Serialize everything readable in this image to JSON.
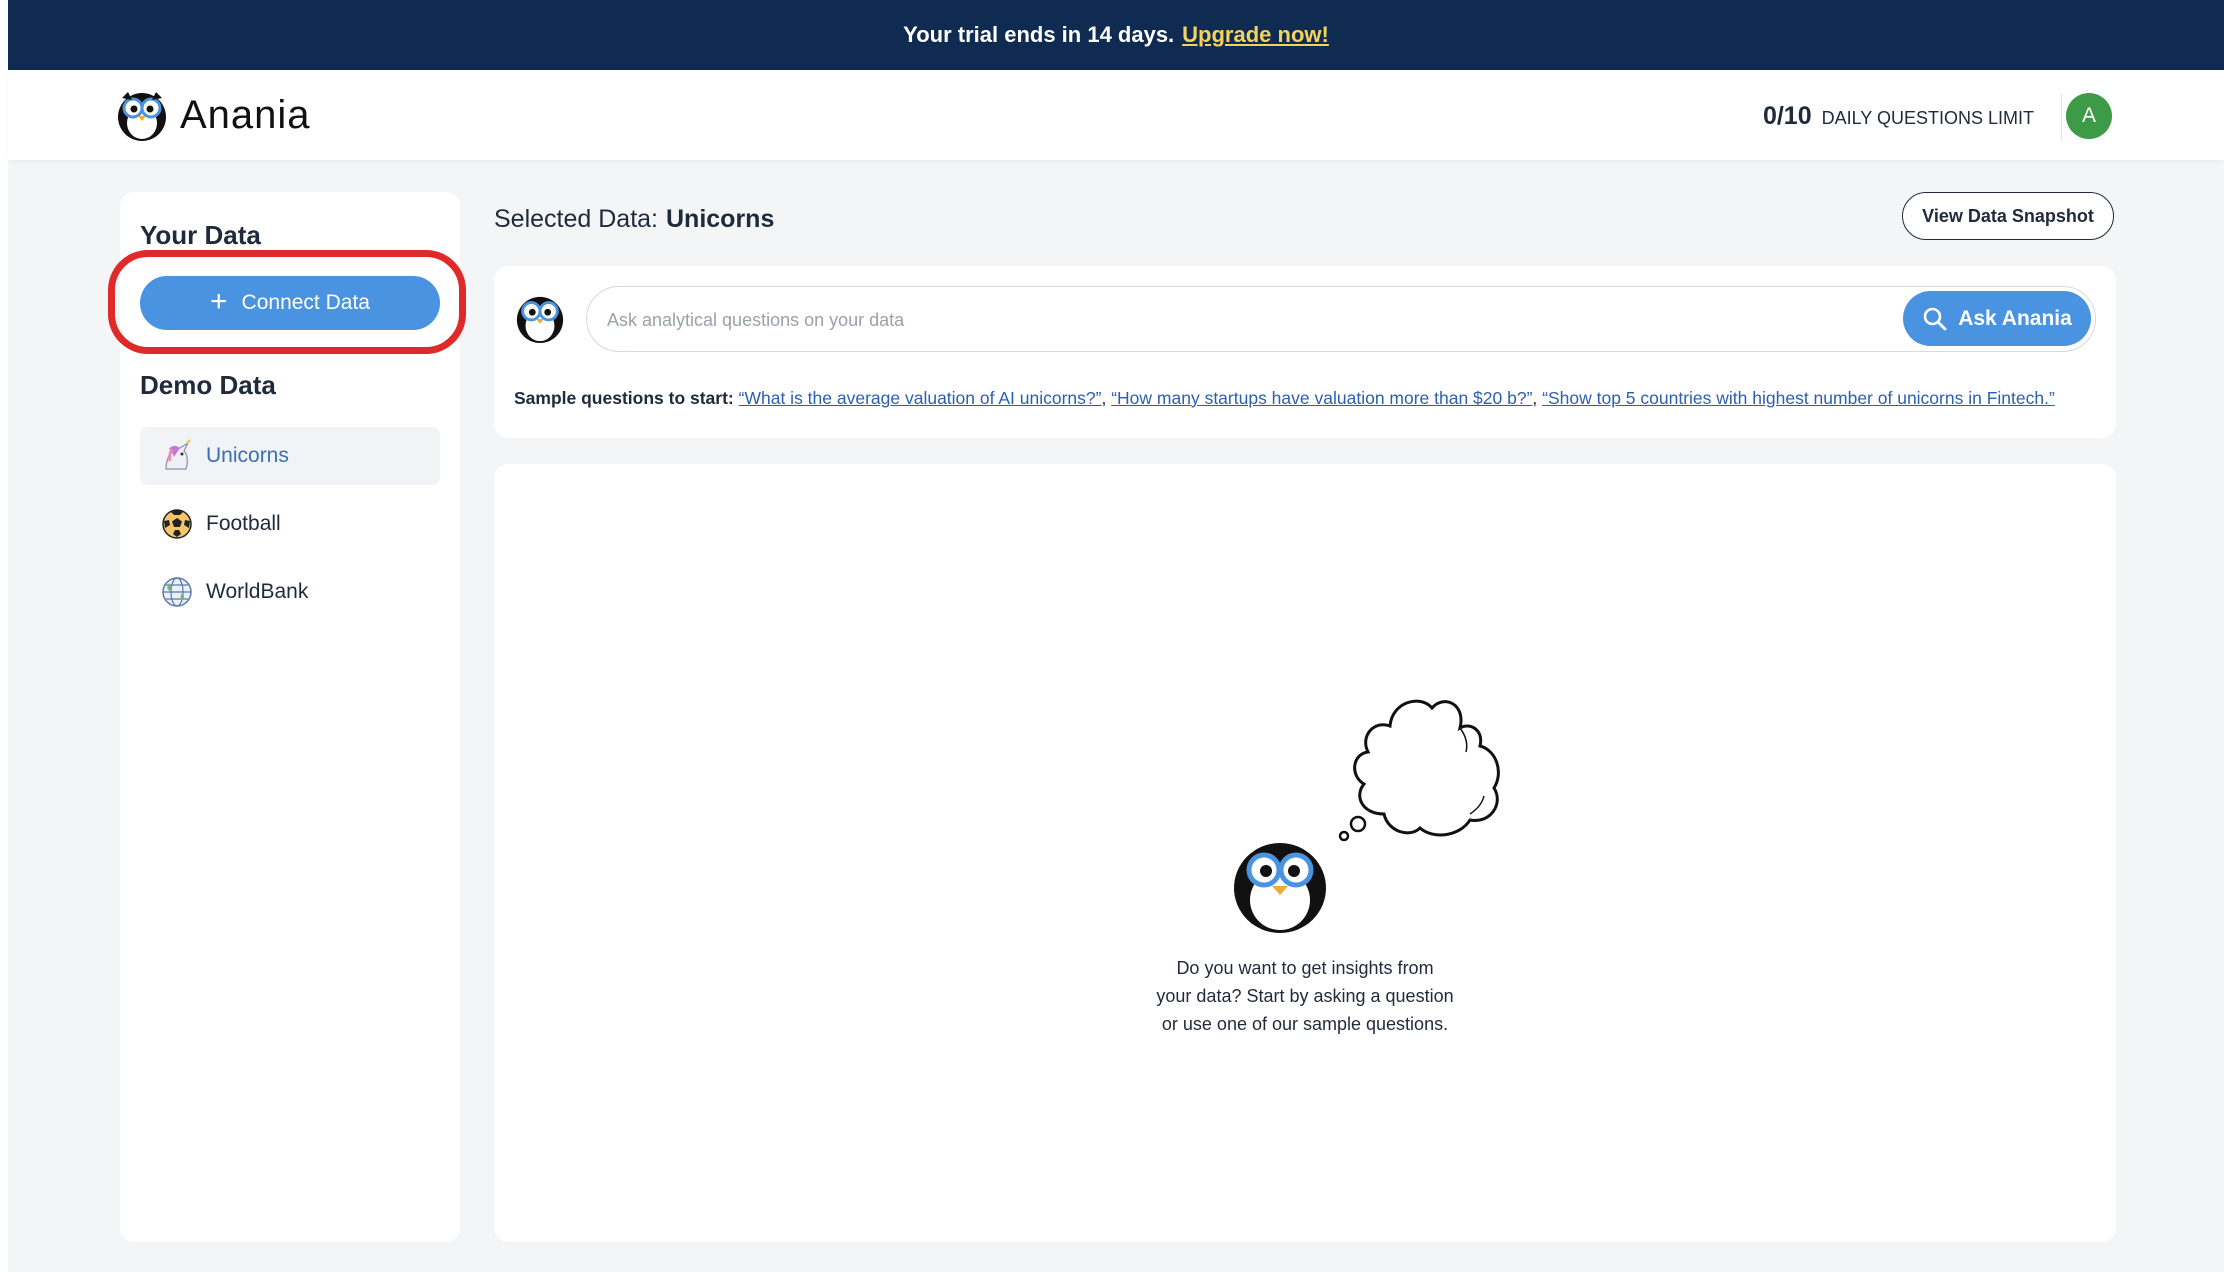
{
  "banner": {
    "text": "Your trial ends in 14 days.",
    "link": "Upgrade now!"
  },
  "header": {
    "brand": "Anania",
    "limit_count": "0/10",
    "limit_label": "DAILY QUESTIONS LIMIT",
    "avatar_initial": "A"
  },
  "sidebar": {
    "your_data_heading": "Your Data",
    "connect_label": "Connect Data",
    "demo_heading": "Demo Data",
    "items": [
      {
        "label": "Unicorns",
        "icon": "unicorn-icon",
        "active": true
      },
      {
        "label": "Football",
        "icon": "football-icon",
        "active": false
      },
      {
        "label": "WorldBank",
        "icon": "globe-icon",
        "active": false
      }
    ]
  },
  "main": {
    "selected_label": "Selected Data:",
    "selected_value": "Unicorns",
    "snapshot_button": "View Data Snapshot",
    "ask_placeholder": "Ask analytical questions on your data",
    "ask_button": "Ask Anania",
    "samples_lead": "Sample questions to start:",
    "samples": [
      "“What is the average valuation of AI unicorns?”",
      "“How many startups have valuation more than $20 b?”",
      "“Show top 5 countries with highest number of unicorns in Fintech.”"
    ],
    "empty_lines": [
      "Do you want to get insights from",
      "your data? Start by asking a question",
      "or use one of our sample questions."
    ]
  },
  "colors": {
    "banner_bg": "#0f2b52",
    "upgrade_link": "#f3d35b",
    "primary_button": "#4a93e0",
    "highlight_ring": "#e02a2a",
    "avatar_bg": "#3d9a46"
  }
}
